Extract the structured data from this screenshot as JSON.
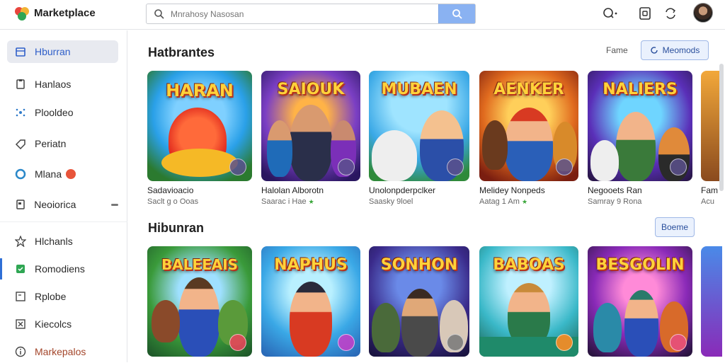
{
  "app": {
    "title": "Marketplace"
  },
  "search": {
    "placeholder": "Mnrahosy Nasosan"
  },
  "sidebar": {
    "items": [
      {
        "label": "Hburran",
        "icon": "store-icon"
      },
      {
        "label": "Hanlaos",
        "icon": "clipboard-icon"
      },
      {
        "label": "Plooldeo",
        "icon": "sparkle-icon"
      },
      {
        "label": "Periatn",
        "icon": "tag-icon"
      },
      {
        "label": "Mlana",
        "icon": "circle-icon",
        "badge": ""
      },
      {
        "label": "Neoiorica",
        "icon": "note-icon"
      },
      {
        "label": "Hlchanls",
        "icon": "star-icon"
      },
      {
        "label": "Romodiens",
        "icon": "green-square-icon"
      },
      {
        "label": "Rplobe",
        "icon": "box-icon"
      },
      {
        "label": "Kiecolcs",
        "icon": "x-box-icon"
      },
      {
        "label": "Markepalos",
        "icon": "info-icon"
      }
    ]
  },
  "section1": {
    "title": "Hatbrantes",
    "link": "Fame",
    "button": "Meomods",
    "cards": [
      {
        "art": "HARAN",
        "name": "Sadavioacio",
        "meta": "Saclt g  o Ooas"
      },
      {
        "art": "SAIOUK",
        "name": "Halolan Alborotn",
        "meta": "Saarac  i  Hae"
      },
      {
        "art": "MUBAEN",
        "name": "Unolonpderpclker",
        "meta": "Saasky 9loel"
      },
      {
        "art": "AENKER",
        "name": "Melidey Nonpeds",
        "meta": "Aatag 1  Am"
      },
      {
        "art": "NALIERS",
        "name": "Negooets Ran",
        "meta": "Samray 9 Rona"
      },
      {
        "art": "",
        "name": "Fam",
        "meta": "Acu"
      }
    ]
  },
  "section2": {
    "title": "Hibunran",
    "button": "Boeme",
    "cards": [
      {
        "art": "BALEEAIS"
      },
      {
        "art": "NAPHUS"
      },
      {
        "art": "SONHON"
      },
      {
        "art": "BABOAS"
      },
      {
        "art": "BESGOLIN"
      },
      {
        "art": ""
      }
    ]
  },
  "colors": {
    "accent": "#2f5fc9",
    "search_button": "#8ab2f2"
  }
}
